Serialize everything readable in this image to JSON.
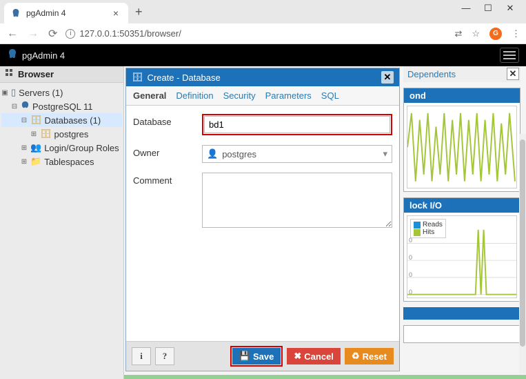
{
  "browser": {
    "tab_title": "pgAdmin 4",
    "url": "127.0.0.1:50351/browser/"
  },
  "app_header": {
    "title": "pgAdmin 4"
  },
  "sidebar": {
    "title": "Browser",
    "tree": {
      "servers": "Servers (1)",
      "pg11": "PostgreSQL 11",
      "databases": "Databases (1)",
      "postgres_db": "postgres",
      "roles": "Login/Group Roles",
      "tablespaces": "Tablespaces"
    }
  },
  "right": {
    "tab_dependents": "Dependents",
    "panel_ond": "ond",
    "panel_blockio": "lock I/O",
    "legend_reads": "Reads",
    "legend_hits": "Hits"
  },
  "dialog": {
    "title": "Create - Database",
    "tabs": {
      "general": "General",
      "definition": "Definition",
      "security": "Security",
      "parameters": "Parameters",
      "sql": "SQL"
    },
    "labels": {
      "database": "Database",
      "owner": "Owner",
      "comment": "Comment"
    },
    "values": {
      "database": "bd1",
      "owner": "postgres",
      "comment": ""
    },
    "buttons": {
      "info": "i",
      "help": "?",
      "save": "Save",
      "cancel": "Cancel",
      "reset": "Reset"
    }
  }
}
